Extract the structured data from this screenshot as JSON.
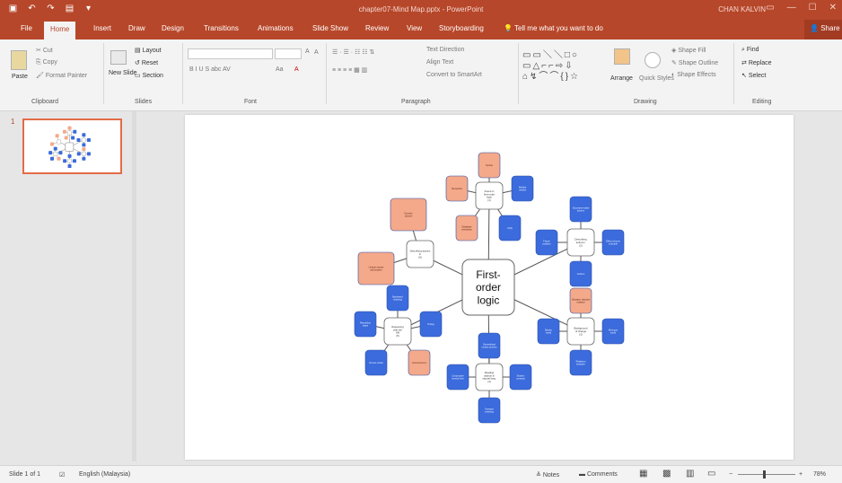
{
  "window": {
    "title": "chapter07-Mind Map.pptx - PowerPoint",
    "user": "CHAN KALVIN",
    "controls": [
      "▭",
      "—",
      "☐",
      "✕"
    ],
    "qat_icons": [
      "save-icon",
      "undo-icon",
      "redo-icon",
      "present-icon",
      "customize-icon"
    ]
  },
  "tabs": [
    "File",
    "Home",
    "Insert",
    "Draw",
    "Design",
    "Transitions",
    "Animations",
    "Slide Show",
    "Review",
    "View",
    "Storyboarding"
  ],
  "tellme": "Tell me what you want to do",
  "share": "Share",
  "ribbon": {
    "clipboard": {
      "label": "Clipboard",
      "paste": "Paste",
      "cut": "Cut",
      "copy": "Copy",
      "format_painter": "Format Painter"
    },
    "slides": {
      "label": "Slides",
      "new_slide": "New Slide",
      "layout": "Layout",
      "reset": "Reset",
      "section": "Section"
    },
    "font": {
      "label": "Font",
      "size_up": "A",
      "size_down": "A",
      "styles": "B  I  U  S  abc  AV",
      "aa": "Aa",
      "color": "A"
    },
    "paragraph": {
      "label": "Paragraph",
      "text_direction": "Text Direction",
      "align_text": "Align Text",
      "smartart": "Convert to SmartArt"
    },
    "drawing": {
      "label": "Drawing",
      "arrange": "Arrange",
      "quick_styles": "Quick Styles",
      "shape_fill": "Shape Fill",
      "shape_outline": "Shape Outline",
      "shape_effects": "Shape Effects"
    },
    "editing": {
      "label": "Editing",
      "find": "Find",
      "replace": "Replace",
      "select": "Select"
    }
  },
  "thumbnail": {
    "number": "1"
  },
  "slide": {
    "central_topic": [
      "First-",
      "order",
      "logic"
    ],
    "branches": [
      {
        "label": [
          "Fluent in",
          "first-order",
          "logic",
          "(1)"
        ]
      },
      {
        "label": [
          "Describing",
          "actions /",
          "(2)"
        ]
      },
      {
        "label": [
          "Background",
          "of change",
          "(3)"
        ]
      },
      {
        "label": [
          "Reading",
          "objects in",
          "natural lang.",
          "(4)"
        ]
      },
      {
        "label": [
          "Reasoning",
          "with the",
          "KB",
          "(5)"
        ]
      },
      {
        "label": [
          "Describing actions",
          "in",
          "(6)"
        ]
      }
    ],
    "subtopics": [
      [
        "Syntax"
      ],
      [
        "Semantics"
      ],
      [
        "Models",
        "nested"
      ],
      [
        "Database",
        "semantics"
      ],
      [
        "Unify"
      ],
      [
        "Successor-state",
        "axioms"
      ],
      [
        "Effect axioms",
        "example"
      ],
      [
        "Frame",
        "problem"
      ],
      [
        "Actions"
      ],
      [
        "Situation calculus",
        "notation"
      ],
      [
        "Blocks",
        "world"
      ],
      [
        "Wumpus",
        "world"
      ],
      [
        "Relations",
        "between"
      ],
      [
        "Generalized",
        "modus ponens"
      ],
      [
        "Conjunctive",
        "normal form"
      ],
      [
        "Skolem",
        "constant"
      ],
      [
        "Forward",
        "chaining"
      ],
      [
        "Backward",
        "chaining"
      ],
      [
        "Resolution",
        "steps"
      ],
      [
        "Prolog"
      ],
      [
        "Occurs check"
      ],
      [
        "Ground terms"
      ],
      [
        "Domain",
        "closure"
      ],
      [
        "Unique names",
        "assumption"
      ],
      [
        "Closed world",
        "assumption"
      ]
    ],
    "colors": {
      "blue": "#3b6bdc",
      "orange": "#f4a98a",
      "center_border": "#666666"
    }
  },
  "status": {
    "slide_counter": "Slide 1 of 1",
    "language": "English (Malaysia)",
    "notes": "Notes",
    "comments": "Comments",
    "zoom": "78%"
  }
}
